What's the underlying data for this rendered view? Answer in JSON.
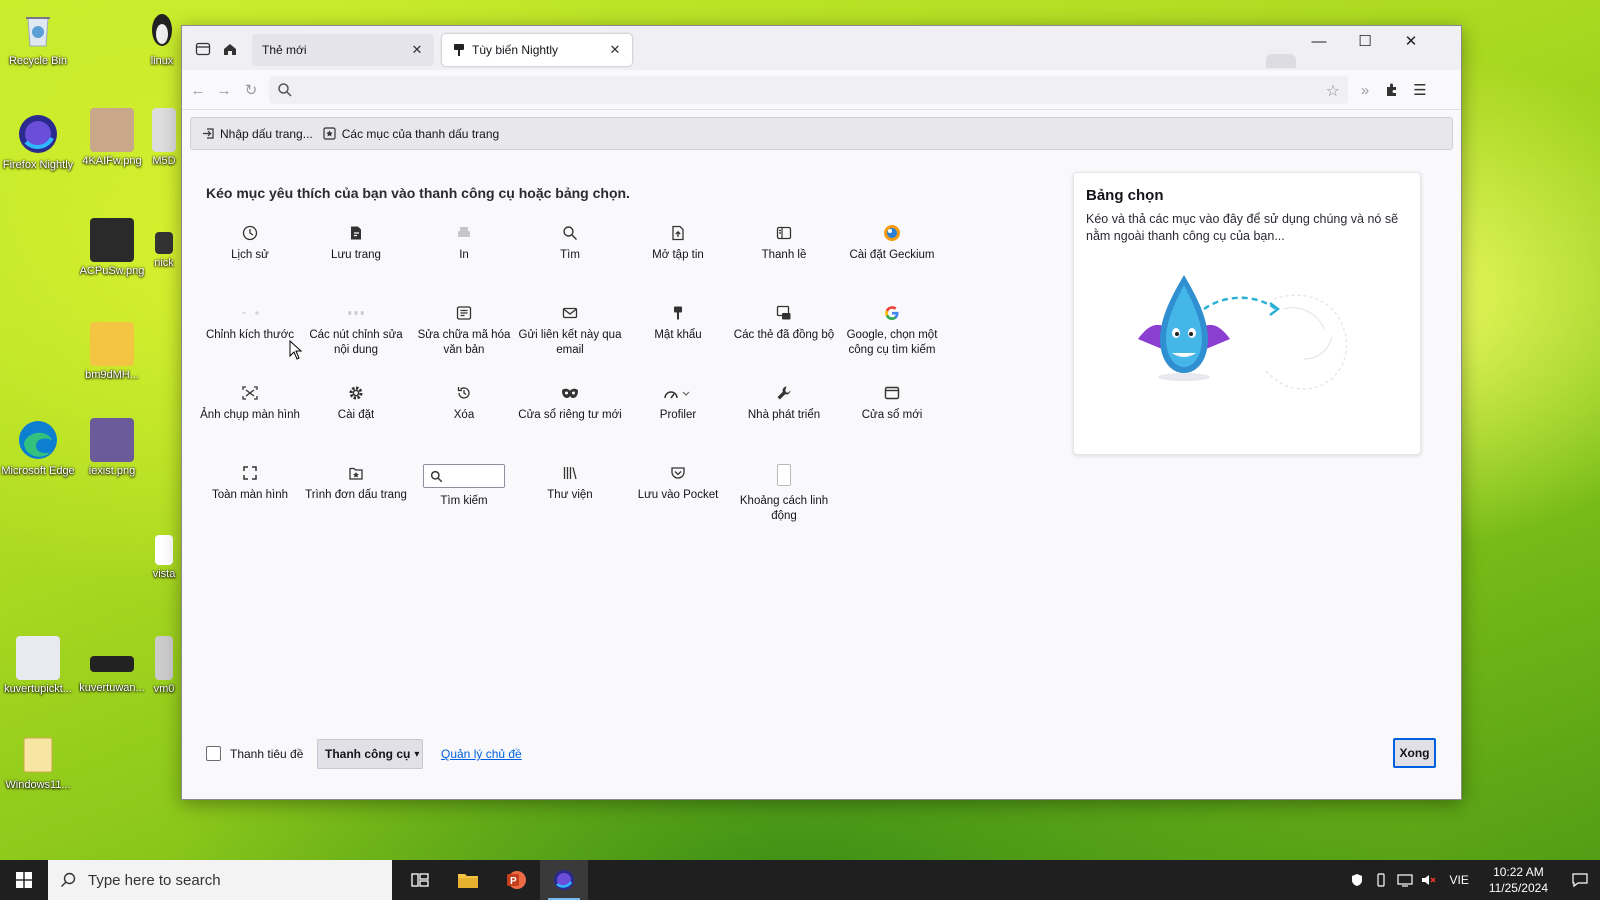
{
  "desktop": {
    "icons": [
      {
        "label": "Recycle Bin"
      },
      {
        "label": "linux"
      },
      {
        "label": "Firefox Nightly"
      },
      {
        "label": "4KAIFw.png"
      },
      {
        "label": "M5D"
      },
      {
        "label": "ACPuSw.png"
      },
      {
        "label": "nick"
      },
      {
        "label": "bm9dMH..."
      },
      {
        "label": "Microsoft Edge"
      },
      {
        "label": "iexist.png"
      },
      {
        "label": "vista"
      },
      {
        "label": "kuvertupickt..."
      },
      {
        "label": "kuvertuwan..."
      },
      {
        "label": "vm0"
      },
      {
        "label": "Windows11..."
      }
    ]
  },
  "browser": {
    "tabs": [
      {
        "title": "Thẻ mới",
        "active": false
      },
      {
        "title": "Tùy biến Nightly",
        "active": true
      }
    ],
    "window_controls": {
      "minimize": "—",
      "maximize": "☐",
      "close": "✕"
    },
    "bookmarks": [
      {
        "label": "Nhập dấu trang...",
        "icon": "import-icon"
      },
      {
        "label": "Các mục của thanh dấu trang",
        "icon": "bookmarks-toolbar-icon"
      }
    ]
  },
  "customize": {
    "instruction": "Kéo mục yêu thích của bạn vào thanh công cụ hoặc bảng chọn.",
    "palette": [
      {
        "label": "Lịch sử",
        "icon": "history-icon"
      },
      {
        "label": "Lưu trang",
        "icon": "save-page-icon"
      },
      {
        "label": "In",
        "icon": "print-icon"
      },
      {
        "label": "Tìm",
        "icon": "find-icon"
      },
      {
        "label": "Mở tập tin",
        "icon": "open-file-icon"
      },
      {
        "label": "Thanh lề",
        "icon": "sidebar-icon"
      },
      {
        "label": "Cài đặt Geckium",
        "icon": "geckium-icon"
      },
      {
        "label": "Chỉnh kích thước",
        "icon": "zoom-controls-icon"
      },
      {
        "label": "Các nút chỉnh sửa nội dung",
        "icon": "edit-controls-icon"
      },
      {
        "label": "Sửa chữa mã hóa văn bản",
        "icon": "text-encoding-icon"
      },
      {
        "label": "Gửi liên kết này qua email",
        "icon": "email-link-icon"
      },
      {
        "label": "Mật khẩu",
        "icon": "passwords-icon"
      },
      {
        "label": "Các thẻ đã đồng bộ",
        "icon": "synced-tabs-icon"
      },
      {
        "label": "Google, chọn một công cụ tìm kiếm",
        "icon": "google-icon"
      },
      {
        "label": "Ảnh chụp màn hình",
        "icon": "screenshot-icon"
      },
      {
        "label": "Cài đặt",
        "icon": "settings-icon"
      },
      {
        "label": "Xóa",
        "icon": "forget-icon"
      },
      {
        "label": "Cửa sổ riêng tư mới",
        "icon": "private-window-icon"
      },
      {
        "label": "Profiler",
        "icon": "profiler-icon"
      },
      {
        "label": "Nhà phát triển",
        "icon": "developer-icon"
      },
      {
        "label": "Cửa sổ mới",
        "icon": "new-window-icon"
      },
      {
        "label": "Toàn màn hình",
        "icon": "fullscreen-icon"
      },
      {
        "label": "Trình đơn dấu trang",
        "icon": "bookmarks-menu-icon"
      },
      {
        "label": "Tìm kiếm",
        "icon": "search-field"
      },
      {
        "label": "Thư viện",
        "icon": "library-icon"
      },
      {
        "label": "Lưu vào Pocket",
        "icon": "pocket-icon"
      },
      {
        "label": "Khoảng cách linh động",
        "icon": "flexible-space"
      }
    ],
    "overflow": {
      "title": "Bảng chọn",
      "description": "Kéo và thả các mục vào đây để sử dụng chúng và nó sẽ nằm ngoài thanh công cụ của bạn..."
    },
    "footer": {
      "title_bar_label": "Thanh tiêu đề",
      "toolbars_label": "Thanh công cụ",
      "manage_themes": "Quản lý chủ đề",
      "done": "Xong"
    }
  },
  "taskbar": {
    "search_placeholder": "Type here to search",
    "language": "VIE",
    "time": "10:22 AM",
    "date": "11/25/2024"
  },
  "colors": {
    "accent": "#0060df",
    "taskbar": "#1f1f1f"
  }
}
